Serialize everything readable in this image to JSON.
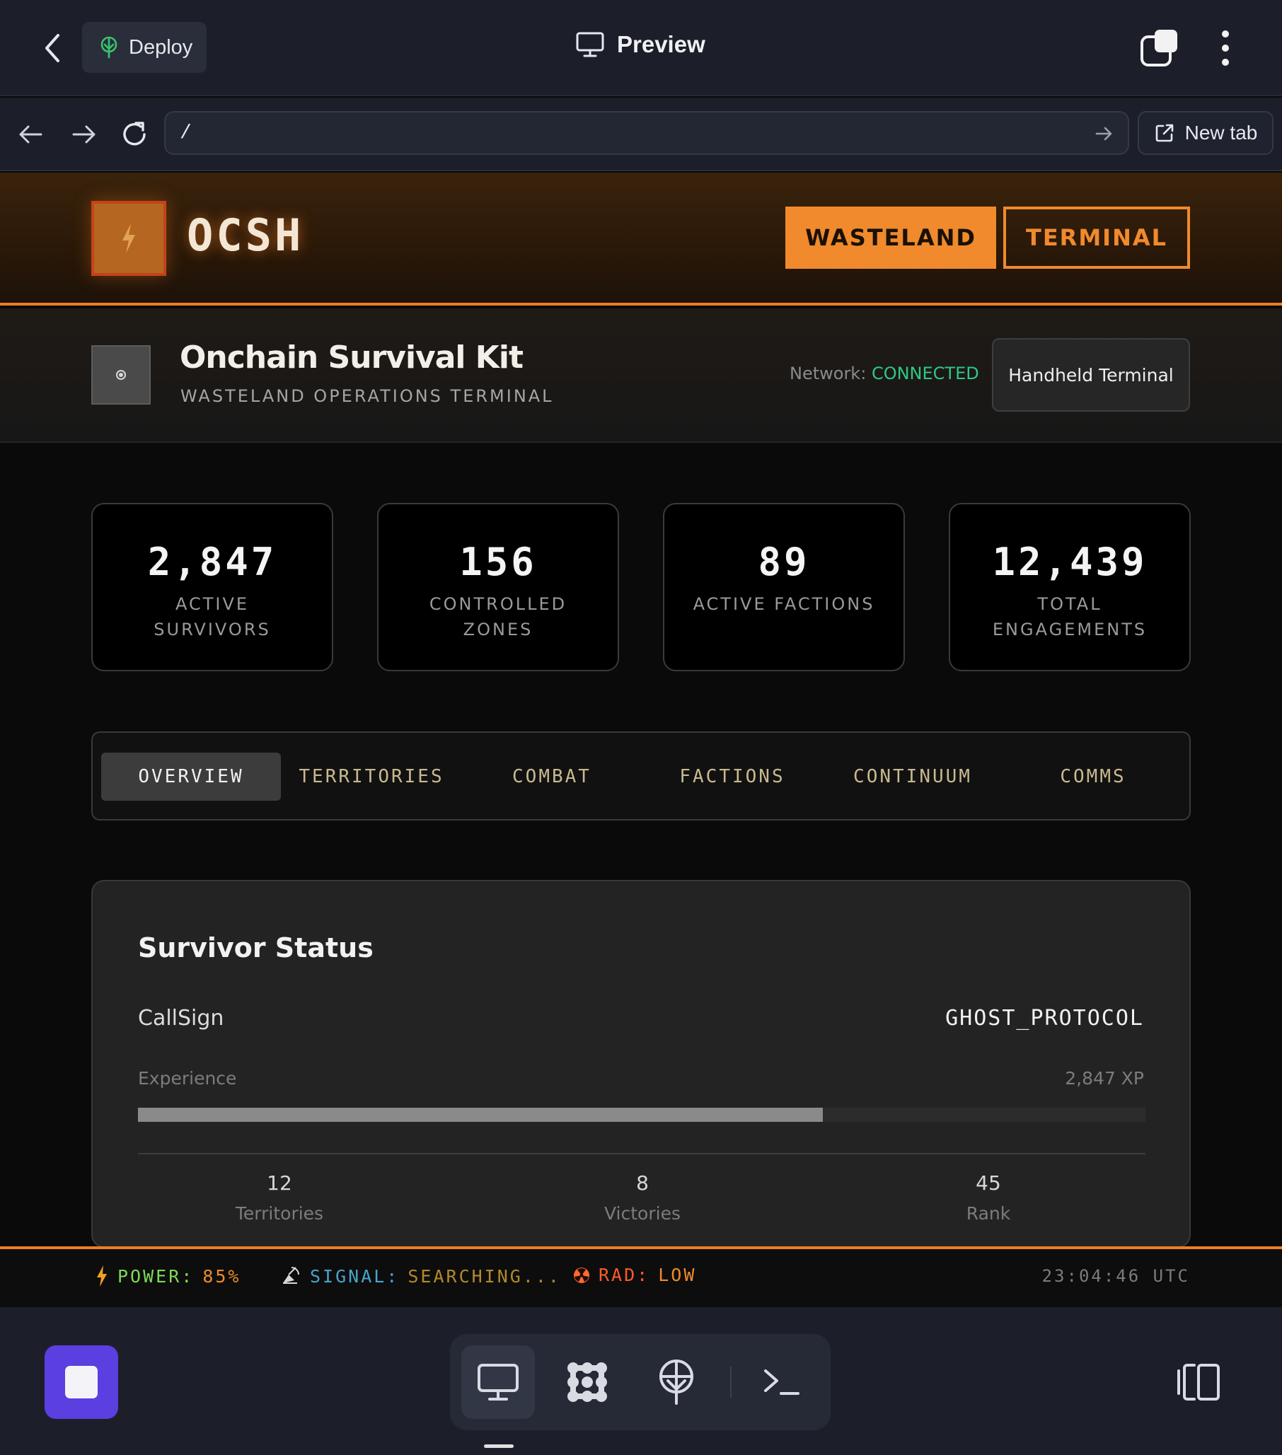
{
  "app_bar": {
    "deploy_label": "Deploy",
    "preview_label": "Preview"
  },
  "browser": {
    "url": "/",
    "new_tab_label": "New tab"
  },
  "site": {
    "brand": "OCSH",
    "nav": {
      "wasteland": "WASTELAND",
      "terminal": "TERMINAL"
    },
    "title": "Onchain Survival Kit",
    "subtitle": "WASTELAND OPERATIONS TERMINAL",
    "network_label": "Network:",
    "network_value": "CONNECTED",
    "handheld_label": "Handheld Terminal"
  },
  "stats": [
    {
      "value": "2,847",
      "label": "ACTIVE SURVIVORS"
    },
    {
      "value": "156",
      "label": "CONTROLLED ZONES"
    },
    {
      "value": "89",
      "label": "ACTIVE FACTIONS"
    },
    {
      "value": "12,439",
      "label": "TOTAL ENGAGEMENTS"
    }
  ],
  "tabs": [
    {
      "label": "OVERVIEW",
      "active": true
    },
    {
      "label": "TERRITORIES",
      "active": false
    },
    {
      "label": "COMBAT",
      "active": false
    },
    {
      "label": "FACTIONS",
      "active": false
    },
    {
      "label": "CONTINUUM",
      "active": false
    },
    {
      "label": "COMMS",
      "active": false
    }
  ],
  "survivor": {
    "title": "Survivor Status",
    "callsign_label": "CallSign",
    "callsign_value": "GHOST_PROTOCOL",
    "experience_label": "Experience",
    "experience_value": "2,847 XP",
    "experience_progress": 0.68,
    "metrics": [
      {
        "value": "12",
        "label": "Territories"
      },
      {
        "value": "8",
        "label": "Victories"
      },
      {
        "value": "45",
        "label": "Rank"
      }
    ]
  },
  "status_bar": {
    "power_label": "POWER:",
    "power_value": "85%",
    "signal_label": "SIGNAL:",
    "signal_value": "SEARCHING...",
    "rad_label": "RAD:",
    "rad_value": "LOW",
    "time": "23:04:46 UTC"
  },
  "colors": {
    "accent": "#f08a2c",
    "connected": "#2fc785",
    "stop_button": "#5b3fe0",
    "power": "#7ed957",
    "signal": "#4aa3c8",
    "rad": "#ff6a2a"
  },
  "icons": {
    "back": "chevron-left-icon",
    "deploy": "deploy-tree-icon",
    "preview": "monitor-icon",
    "tabs": "tabs-stack-icon",
    "more": "more-vertical-icon",
    "nav_back": "arrow-left-icon",
    "nav_forward": "arrow-right-icon",
    "reload": "reload-icon",
    "go": "arrow-right-icon",
    "new_tab": "external-link-icon",
    "logo": "lightning-icon",
    "power": "lightning-icon",
    "signal": "satellite-icon",
    "rad": "radiation-icon"
  }
}
